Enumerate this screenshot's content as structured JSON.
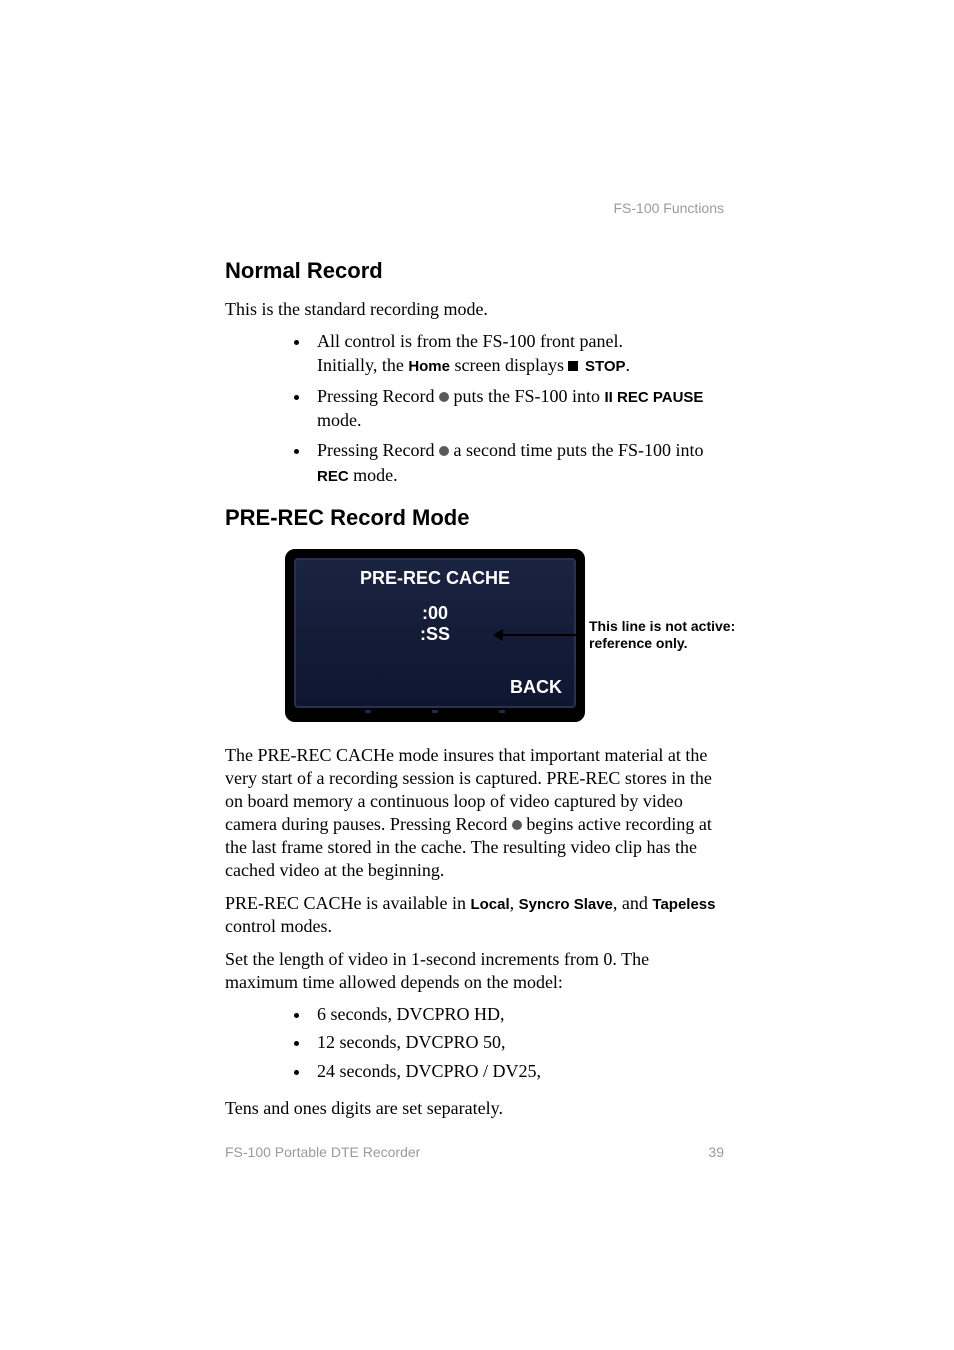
{
  "running_head": "FS-100 Functions",
  "section1": {
    "title": "Normal Record",
    "intro": "This is the standard recording mode.",
    "bullets": {
      "b1a": "All control is from the FS-100 front panel.",
      "b1b_pre": "Initially, the ",
      "b1b_home": "Home",
      "b1b_mid": " screen displays ",
      "b1b_stop": "STOP",
      "b1b_end": ".",
      "b2_pre": "Pressing Record ",
      "b2_mid": " puts the FS-100 into ",
      "b2_mode": "II REC PAUSE",
      "b2_end": " mode.",
      "b3_pre": "Pressing Record ",
      "b3_mid": " a second time puts the FS-100 into ",
      "b3_mode": "REC",
      "b3_end": " mode."
    }
  },
  "section2": {
    "title": "PRE-REC Record Mode",
    "lcd": {
      "title": "PRE-REC CACHE",
      "value1": ":00",
      "value2": ":SS",
      "back": "BACK"
    },
    "callout1": "This line is not active:",
    "callout2": "reference only.",
    "para1": "The PRE-REC CACHe mode insures that important material at the very start of a recording session is captured. PRE-REC stores in the on board memory a continuous loop of video captured by video camera during pauses. Pressing Record ",
    "para1b": " begins active recording at the last frame stored in the cache. The resulting video clip has the cached video at the beginning.",
    "para2_pre": "PRE-REC CACHe is available in ",
    "para2_m1": "Local",
    "para2_s1": ", ",
    "para2_m2": "Syncro Slave",
    "para2_s2": ", and ",
    "para2_m3": "Tapeless",
    "para2_end": " control modes.",
    "para3": "Set the length of video in 1-second increments from 0. The maximum time allowed depends on the model:",
    "times": {
      "t1": "6 seconds, DVCPRO HD,",
      "t2": "12 seconds, DVCPRO 50,",
      "t3": "24 seconds, DVCPRO / DV25,"
    },
    "para4": "Tens and ones digits are set separately."
  },
  "footer": {
    "left": "FS-100 Portable DTE Recorder",
    "right": "39"
  }
}
